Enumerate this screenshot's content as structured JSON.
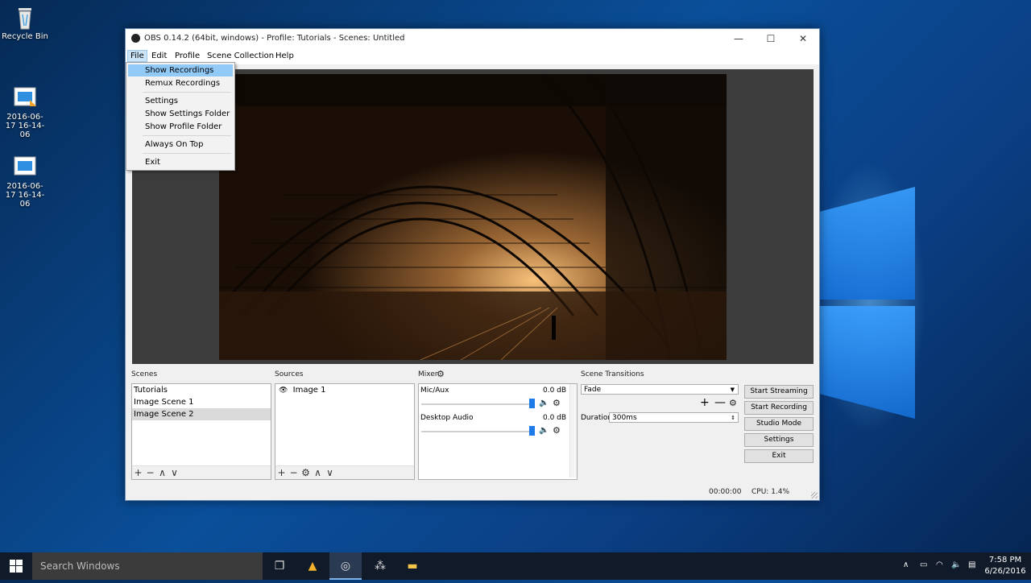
{
  "desktop": {
    "icons": [
      {
        "label": "Recycle Bin",
        "icon": "recycle-bin-icon"
      },
      {
        "label": "2016-06-17 16-14-06",
        "icon": "video-file-icon"
      },
      {
        "label": "2016-06-17 16-14-06",
        "icon": "video-file-icon"
      }
    ]
  },
  "window": {
    "title": "OBS 0.14.2 (64bit, windows) - Profile: Tutorials - Scenes: Untitled",
    "controls": {
      "minimize": "—",
      "maximize": "☐",
      "close": "✕"
    }
  },
  "menubar": {
    "items": [
      "File",
      "Edit",
      "Profile",
      "Scene Collection",
      "Help"
    ],
    "active": "File"
  },
  "file_menu": {
    "items": [
      "Show Recordings",
      "Remux Recordings",
      "Settings",
      "Show Settings Folder",
      "Show Profile Folder",
      "Always On Top",
      "Exit"
    ],
    "highlighted": "Show Recordings"
  },
  "scenes": {
    "label": "Scenes",
    "items": [
      "Tutorials",
      "Image Scene 1",
      "Image Scene 2"
    ],
    "selected": "Image Scene 2",
    "toolbar": [
      "+",
      "−",
      "∧",
      "∨"
    ]
  },
  "sources": {
    "label": "Sources",
    "items": [
      "Image 1"
    ],
    "toolbar": [
      "+",
      "−",
      "⚙",
      "∧",
      "∨"
    ]
  },
  "mixer": {
    "label": "Mixer",
    "channels": [
      {
        "name": "Mic/Aux",
        "level": "0.0 dB"
      },
      {
        "name": "Desktop Audio",
        "level": "0.0 dB"
      }
    ]
  },
  "transitions": {
    "label": "Scene Transitions",
    "selected": "Fade",
    "duration_label": "Duration",
    "duration_value": "300ms"
  },
  "controls": {
    "buttons": [
      "Start Streaming",
      "Start Recording",
      "Studio Mode",
      "Settings",
      "Exit"
    ]
  },
  "statusbar": {
    "time": "00:00:00",
    "cpu": "CPU: 1.4%"
  },
  "taskbar": {
    "search_placeholder": "Search Windows",
    "clock_time": "7:58 PM",
    "clock_date": "6/26/2016"
  },
  "colors": {
    "menu_highlight": "#91c9f7",
    "slider": "#1e7be8",
    "mute": "#d01515"
  }
}
